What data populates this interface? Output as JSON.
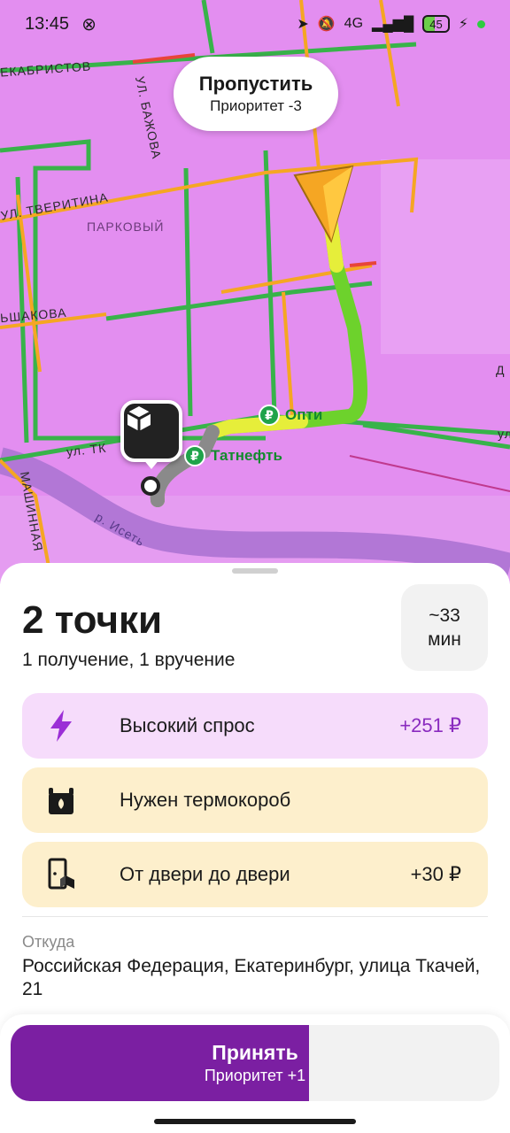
{
  "status_bar": {
    "time": "13:45",
    "network": "4G",
    "battery": "45"
  },
  "map": {
    "skip": {
      "title": "Пропустить",
      "subtitle": "Приоритет -3"
    },
    "streets": [
      "ЕКАБРИСТОВ",
      "УЛ. БАЖОВА",
      "УЛ. ТВЕРИТИНА",
      "ПАРКОВЫЙ",
      "ЬШАКОВА",
      "ул. ТК",
      "р. Исеть",
      "МАШИННАЯ",
      "Д",
      "ул"
    ],
    "pois": {
      "opti": "Опти",
      "tatneft": "Татнефть"
    },
    "icons": {
      "navigation": "navigation-arrow-icon",
      "pickup": "package-icon"
    }
  },
  "order": {
    "title": "2 точки",
    "subtitle": "1 получение, 1 вручение",
    "eta": {
      "value": "~33",
      "unit": "мин"
    },
    "tags": {
      "demand": {
        "label": "Высокий спрос",
        "amount": "+251 ₽",
        "icon": "lightning-icon"
      },
      "thermo": {
        "label": "Нужен термокороб",
        "icon": "thermobox-icon"
      },
      "door": {
        "label": "От двери до двери",
        "amount": "+30 ₽",
        "icon": "door-to-door-icon"
      }
    },
    "from": {
      "label": "Откуда",
      "address": "Российская Федерация, Екатеринбург, улица Ткачей, 21"
    }
  },
  "action": {
    "accept": {
      "title": "Принять",
      "subtitle": "Приоритет +1",
      "progress_percent": 61
    }
  },
  "colors": {
    "map_bg": "#e38ef0",
    "accent_purple": "#7b1fa2",
    "demand_bg": "#f6dcfb",
    "thermo_bg": "#fdefcc"
  }
}
